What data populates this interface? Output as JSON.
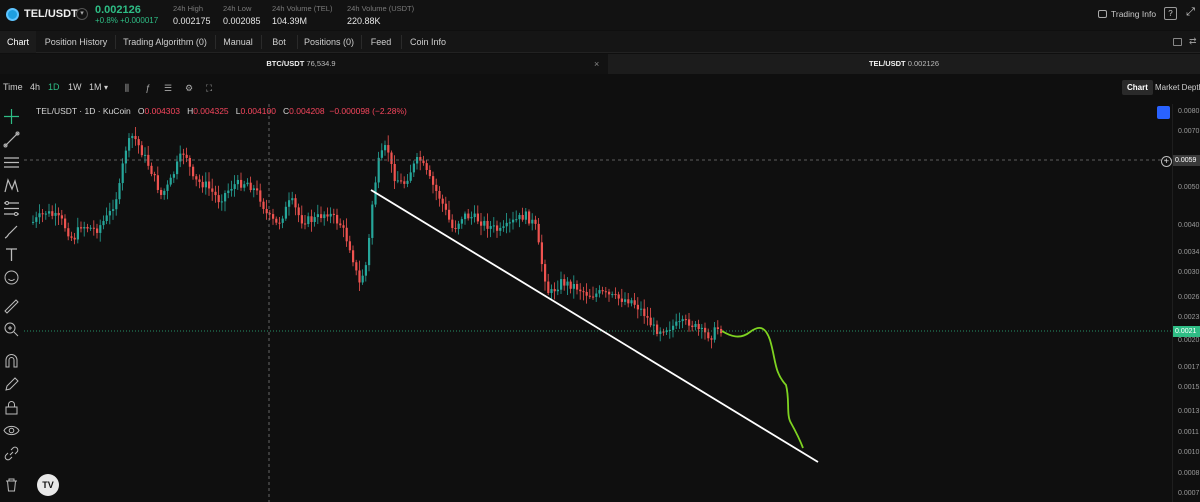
{
  "ticker": {
    "symbol": "TEL/USDT",
    "last_price": "0.002126",
    "change": "+0.8% +0.000017",
    "stats": [
      {
        "label": "24h High",
        "value": "0.002175"
      },
      {
        "label": "24h Low",
        "value": "0.002085"
      },
      {
        "label": "24h Volume (TEL)",
        "value": "104.39M"
      },
      {
        "label": "24h Volume (USDT)",
        "value": "220.88K"
      }
    ],
    "trading_info_label": "Trading Info"
  },
  "tabs": [
    {
      "label": "Chart",
      "active": true
    },
    {
      "label": "Position History",
      "active": false
    },
    {
      "label": "Trading Algorithm (0)",
      "active": false
    },
    {
      "label": "Manual",
      "active": false
    },
    {
      "label": "Bot",
      "active": false
    },
    {
      "label": "Positions (0)",
      "active": false
    },
    {
      "label": "Feed",
      "active": false
    },
    {
      "label": "Coin Info",
      "active": false
    }
  ],
  "pairs": [
    {
      "symbol": "BTC/USDT",
      "price": "76,534.9",
      "active": false
    },
    {
      "symbol": "TEL/USDT",
      "price": "0.002126",
      "active": true
    }
  ],
  "toolbar": {
    "time_label": "Time",
    "intervals": [
      "4h",
      "1D",
      "1W",
      "1M"
    ],
    "active_interval": "1D",
    "views": [
      "Chart",
      "Market Depth"
    ],
    "active_view": "Chart"
  },
  "legend": {
    "title": "TEL/USDT · 1D · KuCoin",
    "open_label": "O",
    "open": "0.004303",
    "high_label": "H",
    "high": "0.004325",
    "low_label": "L",
    "low": "0.004100",
    "close_label": "C",
    "close": "0.004208",
    "change": "−0.000098 (−2.28%)"
  },
  "price_axis": {
    "ticks": [
      "0.0080",
      "0.0070",
      "0.0060",
      "0.0050",
      "0.0040",
      "0.0034",
      "0.0030",
      "0.0026",
      "0.0023",
      "0.0020",
      "0.0017",
      "0.0015",
      "0.0013",
      "0.0011",
      "0.0010",
      "0.0008",
      "0.0007"
    ],
    "crosshair_label": "0.0059",
    "current_label": "0.0021",
    "current_sub": "0.0020"
  },
  "colors": {
    "up": "#26a69a",
    "down": "#ef5350",
    "accent_green": "#2ebd85",
    "projection": "#7ed321",
    "trendline": "#ffffff"
  },
  "logo_text": "TV"
}
